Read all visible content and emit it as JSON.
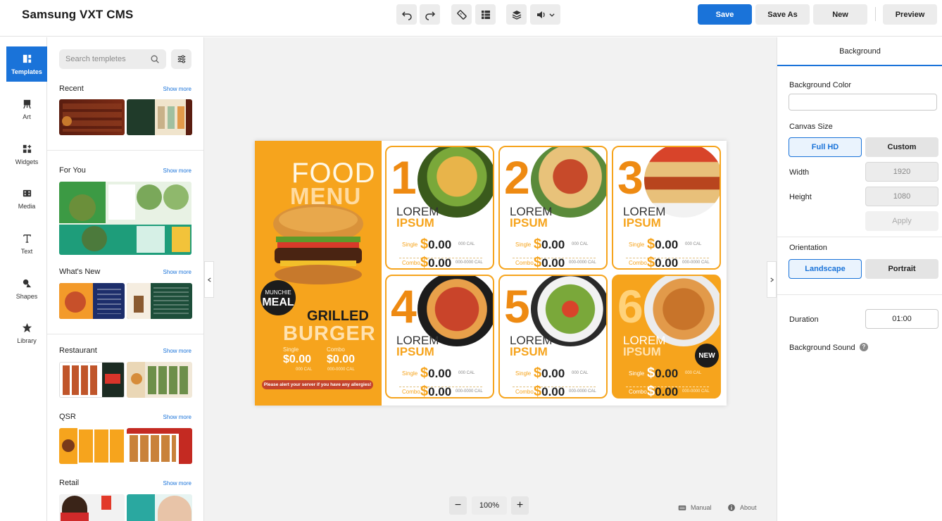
{
  "app": {
    "title": "Samsung VXT CMS"
  },
  "toolbar": {
    "undo": "undo-icon",
    "redo": "redo-icon",
    "ruler": "ruler-icon",
    "grid": "grid-icon",
    "layers": "layers-icon",
    "sound": "speaker-icon",
    "save": "Save",
    "save_as": "Save As",
    "new": "New",
    "preview": "Preview"
  },
  "rail": [
    {
      "label": "Templates",
      "icon": "templates-icon"
    },
    {
      "label": "Art",
      "icon": "art-icon"
    },
    {
      "label": "Widgets",
      "icon": "widgets-icon"
    },
    {
      "label": "Media",
      "icon": "media-icon"
    },
    {
      "label": "Text",
      "icon": "text-icon"
    },
    {
      "label": "Shapes",
      "icon": "shapes-icon"
    },
    {
      "label": "Library",
      "icon": "library-icon"
    }
  ],
  "templates": {
    "search_placeholder": "Search templetes",
    "show_more": "Show more",
    "sections": [
      "Recent",
      "For You",
      "What's New",
      "Restaurant",
      "QSR",
      "Retail"
    ]
  },
  "canvas": {
    "food": "FOOD",
    "menu": "MENU",
    "munchie": "MUNCHIE",
    "meal": "MEAL",
    "grilled": "GRILLED",
    "burger": "BURGER",
    "single": "Single",
    "combo": "Combo",
    "price": "$0.00",
    "price_amount": "0.00",
    "dollar": "$",
    "cal_single": "000 CAL",
    "cal_combo": "000-0000 CAL",
    "allergy": "Please alert your server if you have any allergies!",
    "lorem": "LOREM",
    "ipsum": "IPSUM",
    "new": "NEW",
    "cards": [
      "1",
      "2",
      "3",
      "4",
      "5",
      "6"
    ]
  },
  "zoom": {
    "minus": "−",
    "level": "100%",
    "plus": "+"
  },
  "footer": {
    "manual": "Manual",
    "about": "About"
  },
  "properties": {
    "tab": "Background",
    "background_color": "Background Color",
    "canvas_size": "Canvas Size",
    "full_hd": "Full HD",
    "custom": "Custom",
    "width_label": "Width",
    "width_value": "1920",
    "height_label": "Height",
    "height_value": "1080",
    "apply": "Apply",
    "orientation": "Orientation",
    "landscape": "Landscape",
    "portrait": "Portrait",
    "duration_label": "Duration",
    "duration_value": "01:00",
    "background_sound": "Background Sound",
    "help": "?"
  }
}
